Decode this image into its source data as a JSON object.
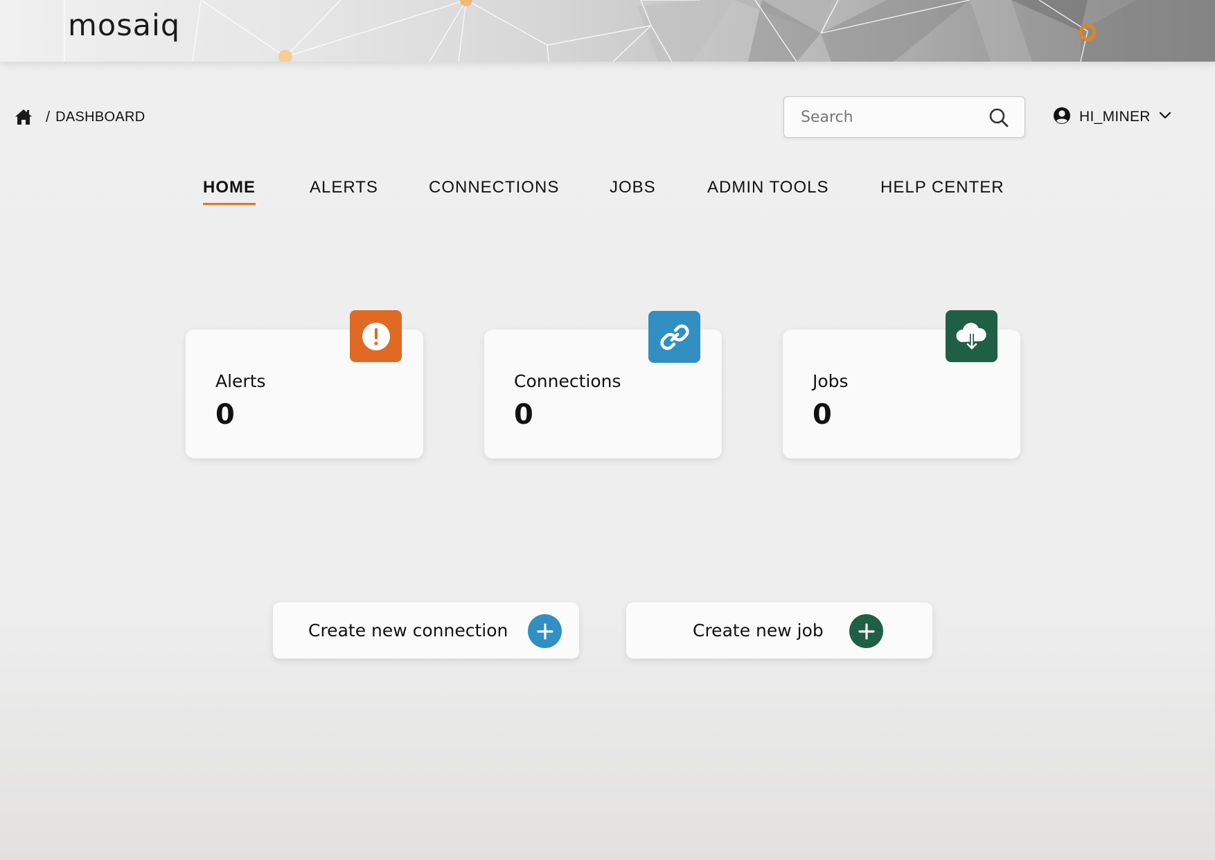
{
  "header": {
    "logo_text": "mosaiq"
  },
  "breadcrumb": {
    "home_icon": "home-icon",
    "separator": "/",
    "current": "DASHBOARD"
  },
  "search": {
    "placeholder": "Search",
    "value": "",
    "icon": "search-icon"
  },
  "user": {
    "icon": "user-circle-icon",
    "name": "HI_MINER",
    "dropdown_icon": "chevron-down-icon"
  },
  "nav": {
    "tabs": [
      {
        "label": "HOME",
        "active": true
      },
      {
        "label": "ALERTS",
        "active": false
      },
      {
        "label": "CONNECTIONS",
        "active": false
      },
      {
        "label": "JOBS",
        "active": false
      },
      {
        "label": "ADMIN TOOLS",
        "active": false
      },
      {
        "label": "HELP CENTER",
        "active": false
      }
    ],
    "active_color": "#e57323"
  },
  "cards": [
    {
      "label": "Alerts",
      "count": "0",
      "icon": "alert-icon",
      "color": "#e06a24"
    },
    {
      "label": "Connections",
      "count": "0",
      "icon": "link-icon",
      "color": "#318fc2"
    },
    {
      "label": "Jobs",
      "count": "0",
      "icon": "cloud-download-icon",
      "color": "#1f5f45"
    }
  ],
  "actions": [
    {
      "label": "Create new connection",
      "icon": "plus-icon",
      "color": "#318fc2"
    },
    {
      "label": "Create new job",
      "icon": "plus-icon",
      "color": "#1f5f45"
    }
  ]
}
